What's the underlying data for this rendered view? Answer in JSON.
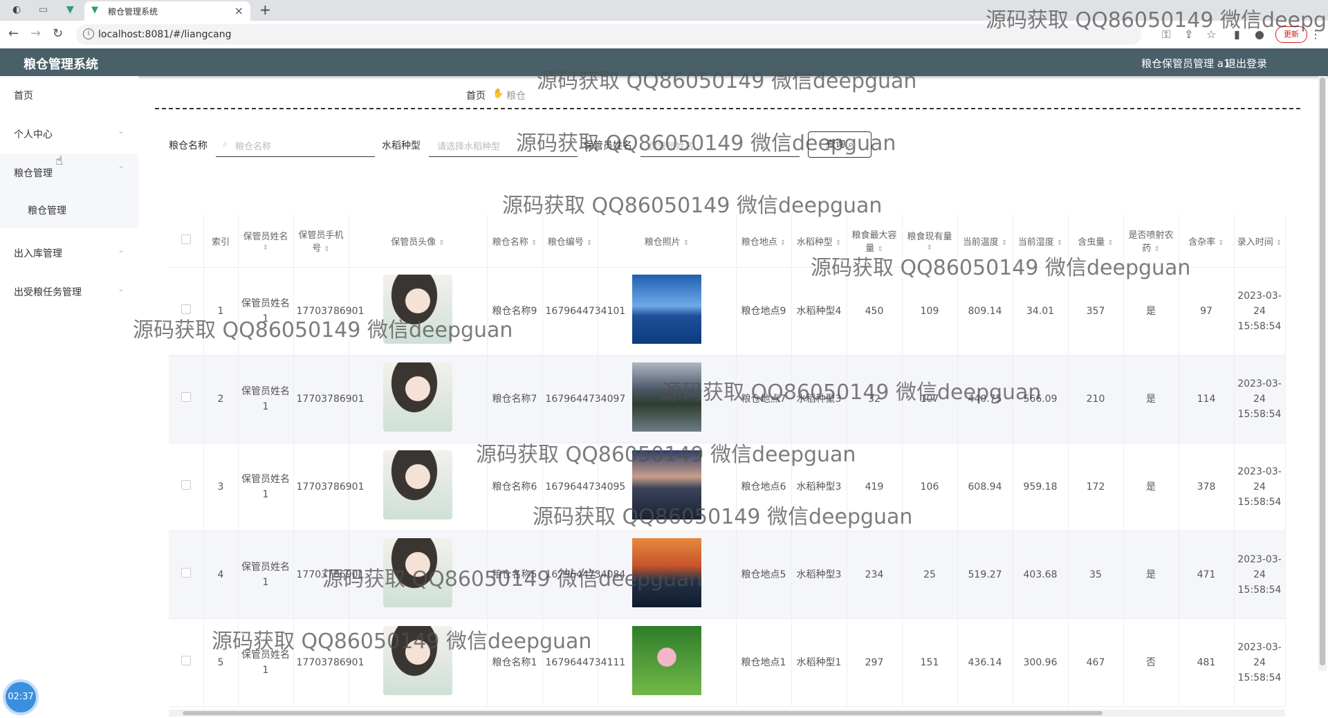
{
  "browser": {
    "tab_title": "粮仓管理系统",
    "url": "localhost:8081/#/liangcang",
    "update_label": "更新"
  },
  "header": {
    "app_title": "粮仓管理系统",
    "user_label": "粮仓保管员管理 a1",
    "logout_label": "退出登录"
  },
  "sidebar": {
    "items": [
      {
        "label": "首页"
      },
      {
        "label": "个人中心"
      },
      {
        "label": "粮仓管理"
      },
      {
        "label": "粮仓管理"
      },
      {
        "label": "出入库管理"
      },
      {
        "label": "出受粮任务管理"
      }
    ]
  },
  "breadcrumb": {
    "home": "首页",
    "current": "粮仓"
  },
  "search": {
    "name_label": "粮仓名称",
    "name_placeholder": "粮仓名称",
    "rice_label": "水稻种型",
    "rice_placeholder": "请选择水稻种型",
    "keeper_label": "保管员姓名",
    "keeper_placeholder": "保管员姓名",
    "query_label": "查询"
  },
  "table": {
    "headers": [
      "索引",
      "保管员姓名",
      "保管员手机号",
      "保管员头像",
      "粮仓名称",
      "粮仓编号",
      "粮仓照片",
      "粮仓地点",
      "水稻种型",
      "粮食最大容量",
      "粮食现有量",
      "当前温度",
      "当前湿度",
      "含虫量",
      "是否喷射农药",
      "含杂率",
      "录入时间"
    ],
    "rows": [
      {
        "idx": "1",
        "keeper": "保管员姓名1",
        "phone": "17703786901",
        "name": "粮仓名称9",
        "code": "1679644734101",
        "loc": "粮仓地点9",
        "rice": "水稻种型4",
        "max": "450",
        "now": "109",
        "temp": "809.14",
        "hum": "34.01",
        "bug": "357",
        "pest": "是",
        "imp": "97",
        "time": "2023-03-24 15:58:54",
        "photo": "p-sea"
      },
      {
        "idx": "2",
        "keeper": "保管员姓名1",
        "phone": "17703786901",
        "name": "粮仓名称7",
        "code": "1679644734097",
        "loc": "粮仓地点7",
        "rice": "水稻种型3",
        "max": "32",
        "now": "107",
        "temp": "440.75",
        "hum": "566.09",
        "bug": "210",
        "pest": "是",
        "imp": "114",
        "time": "2023-03-24 15:58:54",
        "photo": "p-lake"
      },
      {
        "idx": "3",
        "keeper": "保管员姓名1",
        "phone": "17703786901",
        "name": "粮仓名称6",
        "code": "1679644734095",
        "loc": "粮仓地点6",
        "rice": "水稻种型3",
        "max": "419",
        "now": "106",
        "temp": "608.94",
        "hum": "959.18",
        "bug": "172",
        "pest": "是",
        "imp": "378",
        "time": "2023-03-24 15:58:54",
        "photo": "p-city"
      },
      {
        "idx": "4",
        "keeper": "保管员姓名1",
        "phone": "17703786901",
        "name": "粮仓名称5",
        "code": "1679644734084",
        "loc": "粮仓地点5",
        "rice": "水稻种型3",
        "max": "234",
        "now": "25",
        "temp": "519.27",
        "hum": "403.68",
        "bug": "35",
        "pest": "是",
        "imp": "471",
        "time": "2023-03-24 15:58:54",
        "photo": "p-sunset"
      },
      {
        "idx": "5",
        "keeper": "保管员姓名1",
        "phone": "17703786901",
        "name": "粮仓名称1",
        "code": "1679644734111",
        "loc": "粮仓地点1",
        "rice": "水稻种型1",
        "max": "297",
        "now": "151",
        "temp": "436.14",
        "hum": "300.96",
        "bug": "467",
        "pest": "否",
        "imp": "481",
        "time": "2023-03-24 15:58:54",
        "photo": "p-lotus"
      }
    ]
  },
  "clock": "02:37",
  "watermark": "源码获取 QQ86050149 微信deepguan"
}
